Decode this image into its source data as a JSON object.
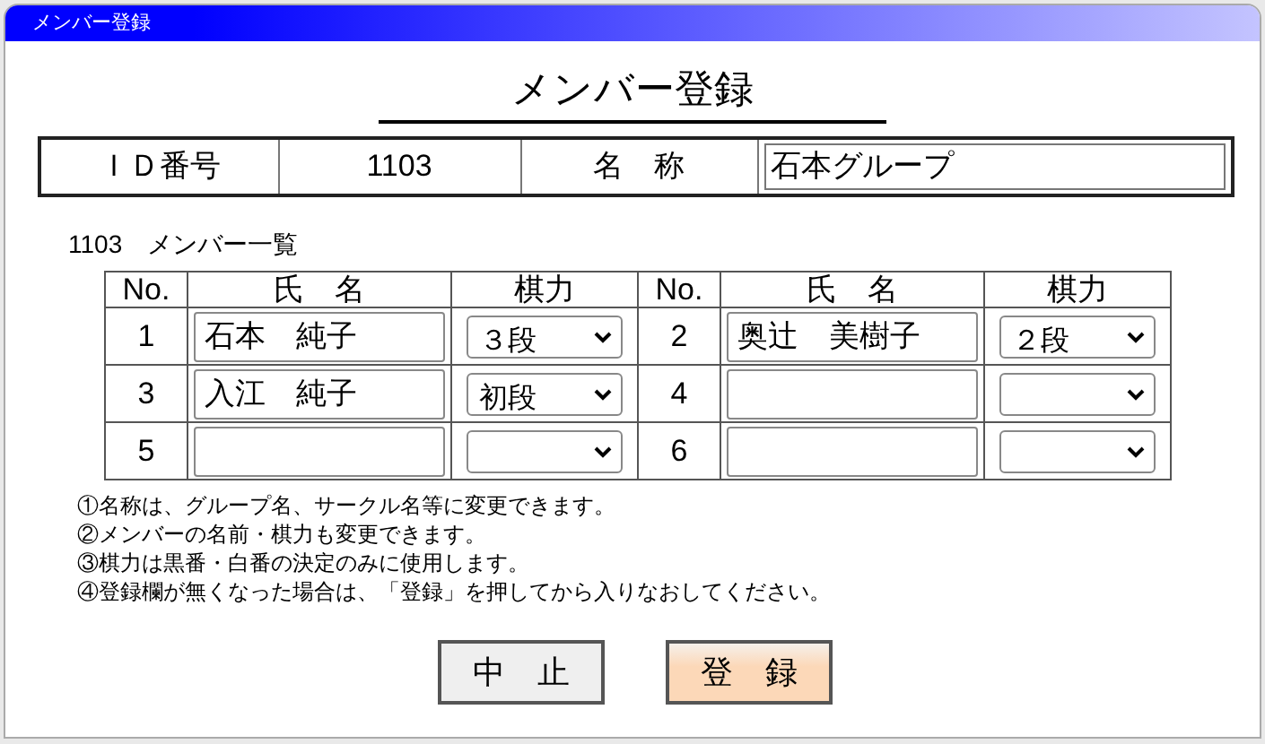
{
  "window": {
    "title": "メンバー登録"
  },
  "heading": "メンバー登録",
  "info": {
    "id_label": "ＩＤ番号",
    "id_value": "1103",
    "name_label": "名　称",
    "name_value": "石本グループ"
  },
  "list_title": "1103　メンバー一覧",
  "columns": [
    "No.",
    "氏　名",
    "棋力",
    "No.",
    "氏　名",
    "棋力"
  ],
  "members": [
    {
      "no": "1",
      "name": "石本　純子",
      "rank": "３段"
    },
    {
      "no": "2",
      "name": "奥辻　美樹子",
      "rank": "２段"
    },
    {
      "no": "3",
      "name": "入江　純子",
      "rank": "初段"
    },
    {
      "no": "4"
    },
    {
      "no": "5"
    },
    {
      "no": "6"
    }
  ],
  "notes": [
    "①名称は、グループ名、サークル名等に変更できます。",
    "②メンバーの名前・棋力も変更できます。",
    "③棋力は黒番・白番の決定のみに使用します。",
    "④登録欄が無くなった場合は、「登録」を押してから入りなおしてください。"
  ],
  "buttons": [
    {
      "label": "中　止",
      "kind": "cancel"
    },
    {
      "label": "登　録",
      "kind": "primary"
    }
  ]
}
